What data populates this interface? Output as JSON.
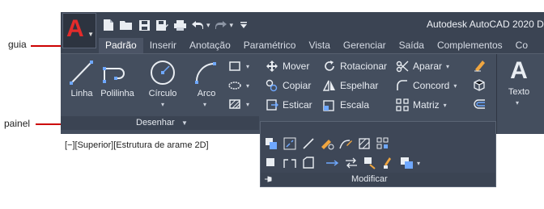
{
  "window": {
    "title": "Autodesk AutoCAD 2020  D"
  },
  "app_menu": {
    "letter": "A"
  },
  "quick_access": [
    {
      "icon": "new-icon"
    },
    {
      "icon": "open-icon"
    },
    {
      "icon": "save-icon"
    },
    {
      "icon": "save-as-icon"
    },
    {
      "icon": "print-icon"
    },
    {
      "icon": "undo-icon"
    },
    {
      "icon": "redo-icon"
    },
    {
      "icon": "customize-icon"
    }
  ],
  "tabs": [
    "Padrão",
    "Inserir",
    "Anotação",
    "Paramétrico",
    "Vista",
    "Gerenciar",
    "Saída",
    "Complementos",
    "Co"
  ],
  "draw_panel": {
    "title": "Desenhar",
    "tools": [
      {
        "label": "Linha",
        "icon": "line-icon"
      },
      {
        "label": "Polilinha",
        "icon": "polyline-icon"
      },
      {
        "label": "Círculo",
        "icon": "circle-icon"
      },
      {
        "label": "Arco",
        "icon": "arc-icon"
      }
    ]
  },
  "modify_tools": [
    {
      "label": "Mover",
      "icon": "move-icon"
    },
    {
      "label": "Rotacionar",
      "icon": "rotate-icon"
    },
    {
      "label": "Aparar",
      "icon": "trim-icon"
    },
    {
      "label": "Copiar",
      "icon": "copy-icon"
    },
    {
      "label": "Espelhar",
      "icon": "mirror-icon"
    },
    {
      "label": "Concord",
      "icon": "fillet-icon"
    },
    {
      "label": "Esticar",
      "icon": "stretch-icon"
    },
    {
      "label": "Escala",
      "icon": "scale-icon"
    },
    {
      "label": "Matriz",
      "icon": "array-icon"
    }
  ],
  "annotation": {
    "label": "Texto",
    "letter": "A"
  },
  "modify_panel": {
    "title": "Modificar"
  },
  "viewport": {
    "label": "[−][Superior][Estrutura de arame 2D]"
  },
  "callouts": {
    "tab": "guia",
    "panel": "painel"
  },
  "colors": {
    "app_bg": "#3b4453",
    "ribbon_bg": "#444e5e",
    "accent_red": "#e32b2b",
    "callout_line": "#cc0000"
  }
}
